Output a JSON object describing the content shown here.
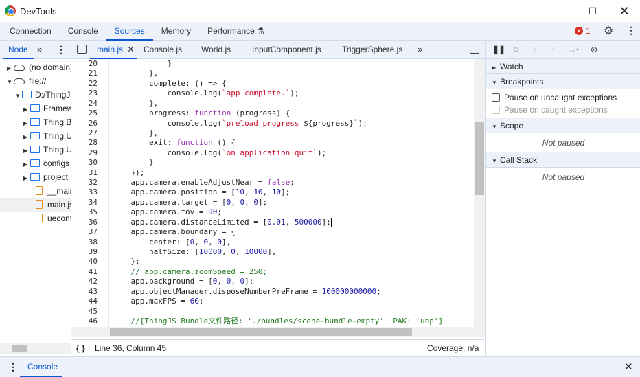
{
  "window": {
    "title": "DevTools",
    "minimize_icon": "minimize-icon",
    "maximize_icon": "maximize-icon",
    "close_icon": "close-icon"
  },
  "main_tabs": [
    {
      "label": "Connection"
    },
    {
      "label": "Console"
    },
    {
      "label": "Sources",
      "active": true
    },
    {
      "label": "Memory"
    },
    {
      "label": "Performance"
    }
  ],
  "error_count": "1",
  "navigator": {
    "tab": "Node",
    "tree": [
      {
        "label": "(no domain)",
        "type": "cloud",
        "depth": 0,
        "expanded": false
      },
      {
        "label": "file://",
        "type": "cloud",
        "depth": 0,
        "expanded": true
      },
      {
        "label": "D:/ThingJS",
        "type": "folder",
        "depth": 1,
        "expanded": true
      },
      {
        "label": "Framework",
        "type": "folder",
        "depth": 2,
        "expanded": false
      },
      {
        "label": "Thing.Bundle",
        "type": "folder",
        "depth": 2,
        "expanded": false
      },
      {
        "label": "Thing.UI",
        "type": "folder",
        "depth": 2,
        "expanded": false
      },
      {
        "label": "Thing.UE",
        "type": "folder",
        "depth": 2,
        "expanded": false
      },
      {
        "label": "configs",
        "type": "folder",
        "depth": 2,
        "expanded": false
      },
      {
        "label": "project",
        "type": "folder",
        "depth": 2,
        "expanded": false
      },
      {
        "label": "__main__.js",
        "type": "file",
        "depth": 2
      },
      {
        "label": "main.js",
        "type": "file",
        "depth": 2,
        "selected": true
      },
      {
        "label": "ueconfig.js",
        "type": "file",
        "depth": 2
      }
    ]
  },
  "editor_tabs": [
    {
      "label": "main.js",
      "active": true,
      "closable": true
    },
    {
      "label": "Console.js"
    },
    {
      "label": "World.js"
    },
    {
      "label": "InputComponent.js"
    },
    {
      "label": "TriggerSphere.js"
    }
  ],
  "code": {
    "first_line": 20,
    "cursor": {
      "line": 36,
      "column": 45
    },
    "lines": [
      [
        [
          "",
          "            }"
        ]
      ],
      [
        [
          "",
          "        },"
        ]
      ],
      [
        [
          "",
          "        complete: () => {"
        ]
      ],
      [
        [
          "",
          "            console.log("
        ],
        [
          "str",
          "`app complete.`"
        ],
        [
          "",
          ");"
        ]
      ],
      [
        [
          "",
          "        },"
        ]
      ],
      [
        [
          "",
          "        progress: "
        ],
        [
          "kw",
          "function"
        ],
        [
          "",
          " (progress) {"
        ]
      ],
      [
        [
          "",
          "            console.log("
        ],
        [
          "str",
          "`preload progress "
        ],
        [
          "",
          "${progress}"
        ],
        [
          "str",
          "`"
        ],
        [
          "",
          ");"
        ]
      ],
      [
        [
          "",
          "        },"
        ]
      ],
      [
        [
          "",
          "        exit: "
        ],
        [
          "kw",
          "function"
        ],
        [
          "",
          " () {"
        ]
      ],
      [
        [
          "",
          "            console.log("
        ],
        [
          "str",
          "`on application quit`"
        ],
        [
          "",
          ");"
        ]
      ],
      [
        [
          "",
          "        }"
        ]
      ],
      [
        [
          "",
          "    });"
        ]
      ],
      [
        [
          "",
          "    app.camera.enableAdjustNear = "
        ],
        [
          "kw",
          "false"
        ],
        [
          "",
          ";"
        ]
      ],
      [
        [
          "",
          "    app.camera.position = ["
        ],
        [
          "num",
          "10"
        ],
        [
          "",
          ", "
        ],
        [
          "num",
          "10"
        ],
        [
          "",
          ", "
        ],
        [
          "num",
          "10"
        ],
        [
          "",
          "];"
        ]
      ],
      [
        [
          "",
          "    app.camera.target = ["
        ],
        [
          "num",
          "0"
        ],
        [
          "",
          ", "
        ],
        [
          "num",
          "0"
        ],
        [
          "",
          ", "
        ],
        [
          "num",
          "0"
        ],
        [
          "",
          "];"
        ]
      ],
      [
        [
          "",
          "    app.camera.fov = "
        ],
        [
          "num",
          "90"
        ],
        [
          "",
          ";"
        ]
      ],
      [
        [
          "",
          "    app.camera.distanceLimited = ["
        ],
        [
          "num",
          "0.01"
        ],
        [
          "",
          ", "
        ],
        [
          "num",
          "500000"
        ],
        [
          "",
          "];"
        ]
      ],
      [
        [
          "",
          "    app.camera.boundary = {"
        ]
      ],
      [
        [
          "",
          "        center: ["
        ],
        [
          "num",
          "0"
        ],
        [
          "",
          ", "
        ],
        [
          "num",
          "0"
        ],
        [
          "",
          ", "
        ],
        [
          "num",
          "0"
        ],
        [
          "",
          "],"
        ]
      ],
      [
        [
          "",
          "        halfSize: ["
        ],
        [
          "num",
          "10000"
        ],
        [
          "",
          ", "
        ],
        [
          "num",
          "0"
        ],
        [
          "",
          ", "
        ],
        [
          "num",
          "10000"
        ],
        [
          "",
          "],"
        ]
      ],
      [
        [
          "",
          "    };"
        ]
      ],
      [
        [
          "cm",
          "    // app.camera.zoomSpeed = 250;"
        ]
      ],
      [
        [
          "",
          "    app.background = ["
        ],
        [
          "num",
          "0"
        ],
        [
          "",
          ", "
        ],
        [
          "num",
          "0"
        ],
        [
          "",
          ", "
        ],
        [
          "num",
          "0"
        ],
        [
          "",
          "];"
        ]
      ],
      [
        [
          "",
          "    app.objectManager.disposeNumberPreFrame = "
        ],
        [
          "num",
          "100000000000"
        ],
        [
          "",
          ";"
        ]
      ],
      [
        [
          "",
          "    app.maxFPS = "
        ],
        [
          "num",
          "60"
        ],
        [
          "",
          ";"
        ]
      ],
      [
        [
          "",
          ""
        ]
      ],
      [
        [
          "cm",
          "    //[ThingJS Bundle文件路径: './bundles/scene-bundle-empty'  PAK: 'ubp']"
        ]
      ]
    ]
  },
  "status": {
    "position": "Line 36, Column 45",
    "coverage": "Coverage: n/a"
  },
  "debugger": {
    "sections": {
      "watch": "Watch",
      "breakpoints": "Breakpoints",
      "scope": "Scope",
      "call_stack": "Call Stack"
    },
    "pause_uncaught": "Pause on uncaught exceptions",
    "pause_caught": "Pause on caught exceptions",
    "not_paused": "Not paused"
  },
  "drawer": {
    "tab": "Console"
  }
}
